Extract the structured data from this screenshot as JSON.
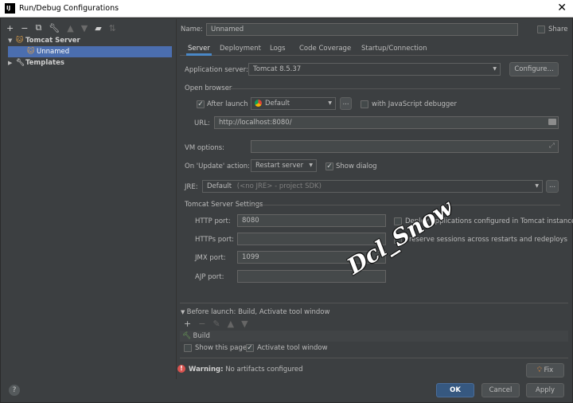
{
  "window": {
    "title": "Run/Debug Configurations",
    "app_icon": "IJ"
  },
  "left_toolbar": {
    "icons": [
      "add-icon",
      "remove-icon",
      "copy-icon",
      "wrench-icon",
      "move-up-icon",
      "move-down-icon",
      "folder-icon",
      "sort-icon"
    ]
  },
  "tree": {
    "group": "Tomcat Server",
    "selected": "Unnamed",
    "templates": "Templates"
  },
  "name_row": {
    "label": "Name:",
    "value": "Unnamed",
    "share_label": "Share"
  },
  "tabs": [
    "Server",
    "Deployment",
    "Logs",
    "Code Coverage",
    "Startup/Connection"
  ],
  "server": {
    "app_server_label": "Application server:",
    "app_server_value": "Tomcat 8.5.37",
    "configure_button": "Configure...",
    "open_browser_title": "Open browser",
    "after_launch_label": "After launch",
    "browser_value": "Default",
    "browse_button": "...",
    "js_debugger_label": "with JavaScript debugger",
    "url_label": "URL:",
    "url_value": "http://localhost:8080/",
    "vm_options_label": "VM options:",
    "on_update_label": "On 'Update' action:",
    "on_update_value": "Restart server",
    "show_dialog_label": "Show dialog",
    "jre_label": "JRE:",
    "jre_value": "Default",
    "jre_hint": "(<no JRE> - project SDK)",
    "jre_button": "...",
    "tomcat_settings_title": "Tomcat Server Settings",
    "http_port_label": "HTTP port:",
    "http_port_value": "8080",
    "https_port_label": "HTTPs port:",
    "https_port_value": "",
    "jmx_port_label": "JMX port:",
    "jmx_port_value": "1099",
    "ajp_port_label": "AJP port:",
    "ajp_port_value": "",
    "deploy_label": "Deploy applications configured in Tomcat instance",
    "preserve_label": "Preserve sessions across restarts and redeploys"
  },
  "before_launch": {
    "title": "Before launch: Build, Activate tool window",
    "toolbar_icons": [
      "add-icon",
      "remove-icon",
      "edit-icon",
      "up-icon",
      "down-icon"
    ],
    "item": "Build",
    "show_page_label": "Show this page",
    "activate_label": "Activate tool window"
  },
  "warning": {
    "bold": "Warning:",
    "text": "No artifacts configured",
    "fix_button": "Fix"
  },
  "footer": {
    "help": "?",
    "ok": "OK",
    "cancel": "Cancel",
    "apply": "Apply"
  },
  "watermark": "Dcl_Snow",
  "colors": {
    "accent": "#4b6eaf",
    "background": "#3c3f41",
    "primary_button": "#365880",
    "warning_icon": "#d9534f"
  }
}
